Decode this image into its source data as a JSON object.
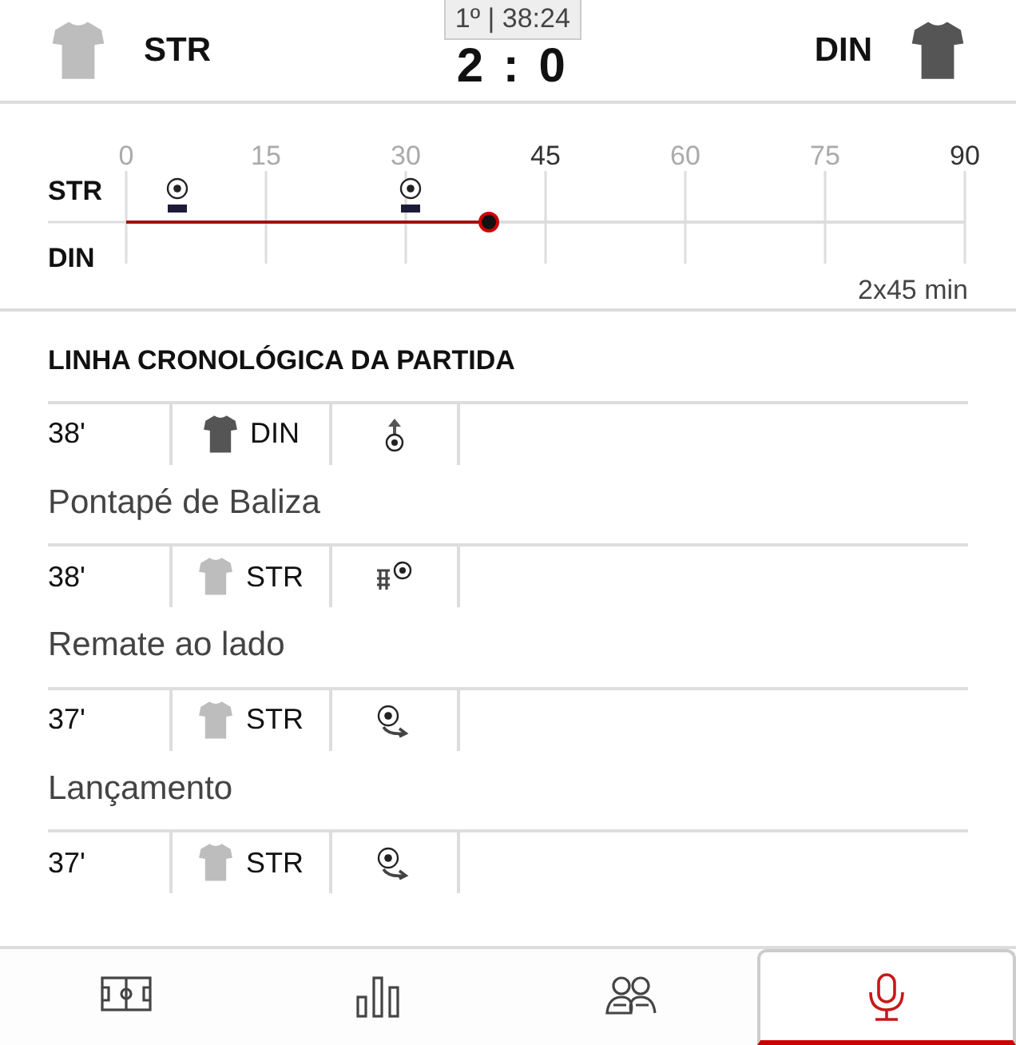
{
  "header": {
    "home": {
      "name": "STR",
      "color": "#bdbdbd"
    },
    "away": {
      "name": "DIN",
      "color": "#555555"
    },
    "clock": "1º | 38:24",
    "score": "2 : 0"
  },
  "timeline": {
    "teams": [
      "STR",
      "DIN"
    ],
    "ticks": [
      {
        "label": "0",
        "major": false
      },
      {
        "label": "15",
        "major": false
      },
      {
        "label": "30",
        "major": false
      },
      {
        "label": "45",
        "major": true
      },
      {
        "label": "60",
        "major": false
      },
      {
        "label": "75",
        "major": false
      },
      {
        "label": "90",
        "major": true
      }
    ],
    "progress": {
      "level": 0.432
    },
    "format": "2x45 min"
  },
  "section_title": "LINHA CRONOLÓGICA DA PARTIDA",
  "events": [
    {
      "minute": "38'",
      "team": "DIN",
      "color": "#555555",
      "kind": "goal-kick",
      "description": "Pontapé de Baliza"
    },
    {
      "minute": "38'",
      "team": "STR",
      "color": "#bdbdbd",
      "kind": "shot-wide",
      "description": "Remate ao lado"
    },
    {
      "minute": "37'",
      "team": "STR",
      "color": "#bdbdbd",
      "kind": "pass",
      "description": "Lançamento"
    },
    {
      "minute": "37'",
      "team": "STR",
      "color": "#bdbdbd",
      "kind": "pass"
    }
  ],
  "nav": [
    {
      "kind": "pitch",
      "selected": false
    },
    {
      "kind": "stats",
      "selected": false
    },
    {
      "kind": "lineups",
      "selected": false
    },
    {
      "kind": "commentary",
      "selected": true
    }
  ]
}
